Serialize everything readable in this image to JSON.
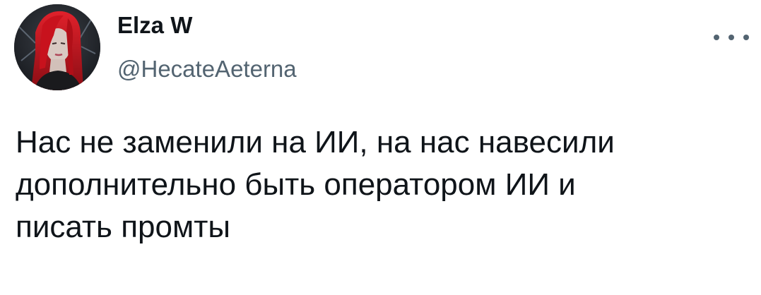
{
  "author": {
    "display_name": "Elza W",
    "handle": "@HecateAeterna",
    "avatar_icon": "profile-avatar-red-hair"
  },
  "more_icon": "more-options-icon",
  "tweet": {
    "lines": [
      "Нас не заменили на ИИ, на нас навесили",
      "дополнительно быть оператором ИИ и",
      "писать промты"
    ]
  }
}
